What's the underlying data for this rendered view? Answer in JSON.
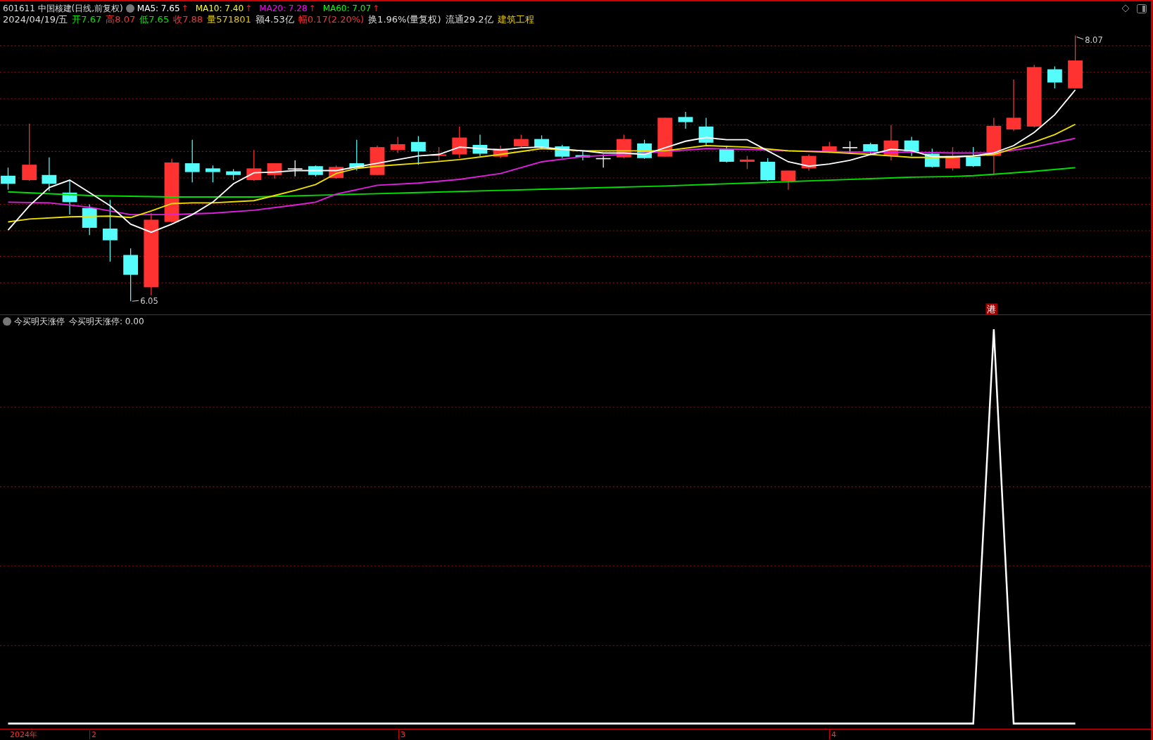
{
  "header": {
    "stock": "601611 中国核建(日线,前复权)",
    "moving_averages": [
      {
        "label": "MA5: 7.65",
        "arrow": "↑",
        "color": "#ffffff"
      },
      {
        "label": "MA10: 7.40",
        "arrow": "↑",
        "color": "#ffff00"
      },
      {
        "label": "MA20: 7.28",
        "arrow": "↑",
        "color": "#ff00ff"
      },
      {
        "label": "MA60: 7.07",
        "arrow": "↑",
        "color": "#00ff00"
      }
    ],
    "quote": [
      {
        "text": "2024/04/19/五",
        "color": "#dddddd"
      },
      {
        "text": "开7.67",
        "color": "#00e600"
      },
      {
        "text": "高8.07",
        "color": "#ff3232"
      },
      {
        "text": "低7.65",
        "color": "#00e600"
      },
      {
        "text": "收7.88",
        "color": "#ff3232"
      },
      {
        "text": "量571801",
        "color": "#e6c800"
      },
      {
        "text": "额4.53亿",
        "color": "#dddddd"
      },
      {
        "text": "幅0.17(2.20%)",
        "color": "#ff3232"
      },
      {
        "text": "换1.96%(量复权)",
        "color": "#dddddd"
      },
      {
        "text": "流通29.2亿",
        "color": "#dddddd"
      },
      {
        "text": "建筑工程",
        "color": "#e6c800"
      }
    ]
  },
  "price_chart": {
    "high_label": "8.07",
    "low_label": "6.05",
    "badge": "港"
  },
  "indicator": {
    "name": "今买明天涨停",
    "value": "今买明天涨停: 0.00"
  },
  "time_axis": [
    {
      "label": "2024年"
    },
    {
      "label": "2"
    },
    {
      "label": "3"
    },
    {
      "label": "4"
    }
  ]
}
